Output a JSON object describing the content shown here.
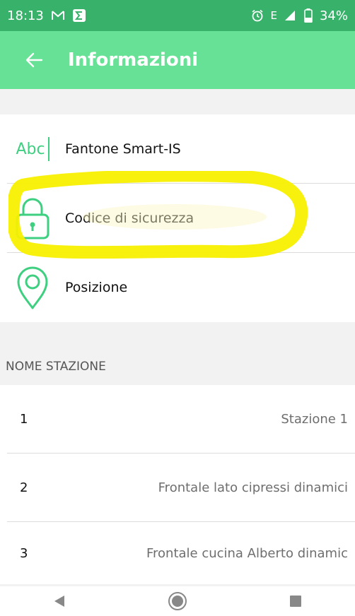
{
  "status_bar": {
    "time": "18:13",
    "network": "E",
    "battery": "34%"
  },
  "app_bar": {
    "title": "Informazioni",
    "back_icon": "arrow-back-icon"
  },
  "info": {
    "items": [
      {
        "icon": "abc-text-icon",
        "icon_text": "Abc",
        "label": "Fantone Smart-IS"
      },
      {
        "icon": "lock-icon",
        "label": "Codice di sicurezza"
      },
      {
        "icon": "location-pin-icon",
        "label": "Posizione"
      }
    ]
  },
  "stations": {
    "section_title": "NOME STAZIONE",
    "rows": [
      {
        "number": "1",
        "name": "Stazione 1"
      },
      {
        "number": "2",
        "name": "Frontale lato cipressi dinamici"
      },
      {
        "number": "3",
        "name": "Frontale cucina Alberto dinamic"
      }
    ]
  },
  "colors": {
    "status_bar": "#38b26a",
    "app_bar": "#66e195",
    "accent_icon": "#3ecf80",
    "highlight_marker": "#f7f000"
  }
}
